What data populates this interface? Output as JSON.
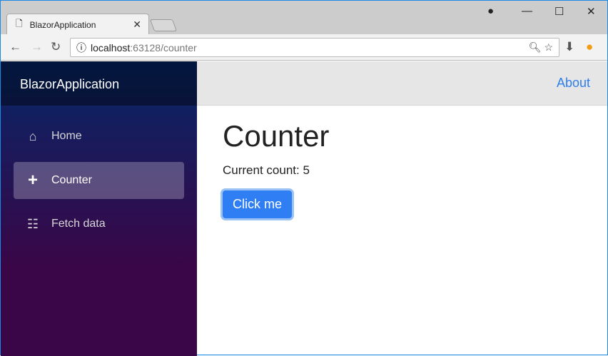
{
  "browser": {
    "tab_title": "BlazorApplication",
    "url_host": "localhost",
    "url_path": ":63128/counter"
  },
  "sidebar": {
    "brand": "BlazorApplication",
    "items": [
      {
        "label": "Home",
        "icon": "home-icon"
      },
      {
        "label": "Counter",
        "icon": "plus-icon"
      },
      {
        "label": "Fetch data",
        "icon": "list-icon"
      }
    ]
  },
  "topbar": {
    "about": "About"
  },
  "main": {
    "title": "Counter",
    "count_label": "Current count: 5",
    "button": "Click me"
  }
}
